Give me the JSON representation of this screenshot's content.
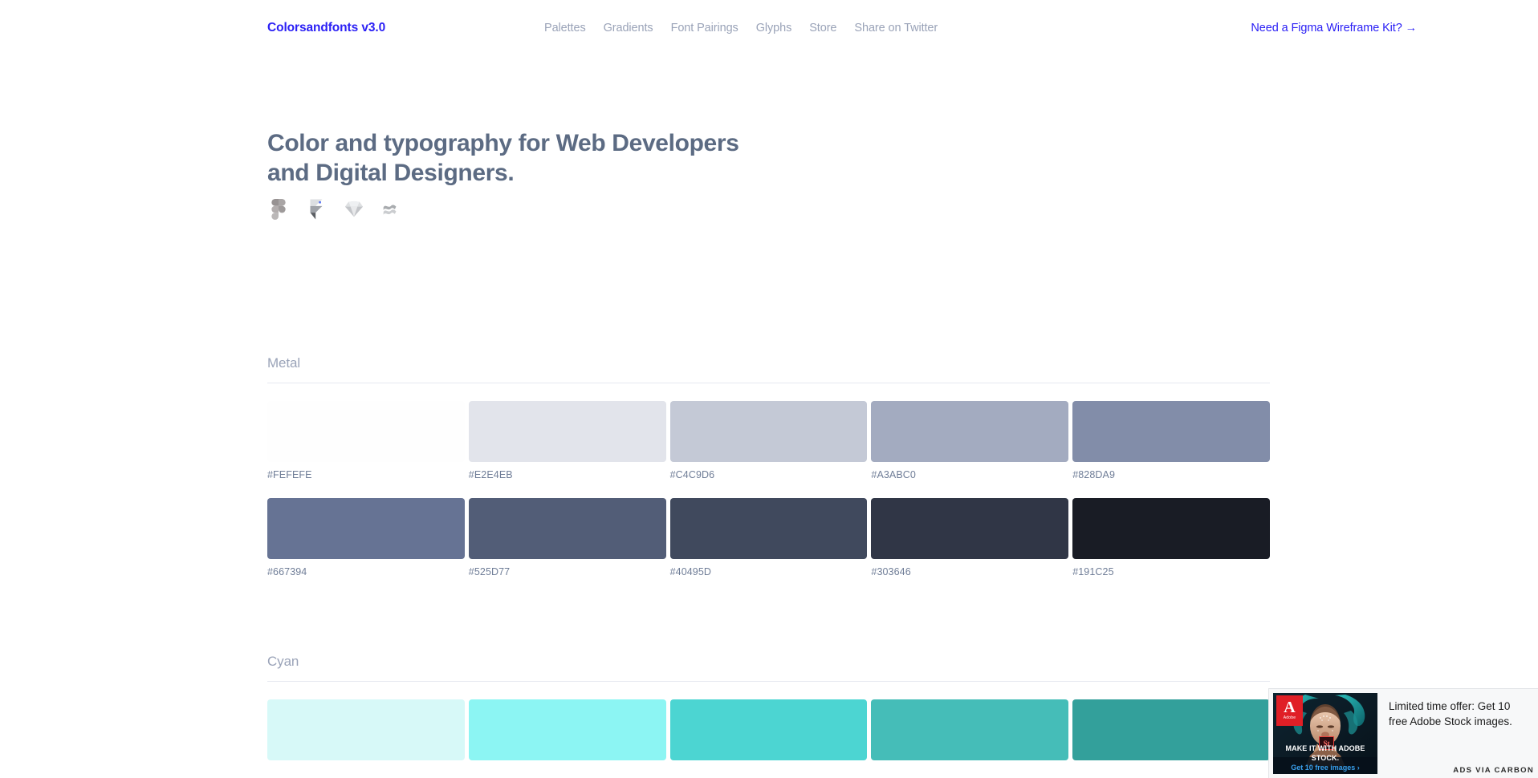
{
  "header": {
    "brand": "Colorsandfonts v3.0",
    "nav": [
      {
        "label": "Palettes",
        "name": "nav-palettes"
      },
      {
        "label": "Gradients",
        "name": "nav-gradients"
      },
      {
        "label": "Font Pairings",
        "name": "nav-font-pairings"
      },
      {
        "label": "Glyphs",
        "name": "nav-glyphs"
      },
      {
        "label": "Store",
        "name": "nav-store"
      },
      {
        "label": "Share on Twitter",
        "name": "nav-share-twitter"
      }
    ],
    "cta": "Need a Figma Wireframe Kit? →",
    "brand_color": "#2B20F5"
  },
  "hero": {
    "line1": "Color and typography for Web Developers",
    "line2": "and Digital Designers.",
    "title_color": "#5C6B83",
    "tools": [
      {
        "name": "figma-icon",
        "label": "Figma"
      },
      {
        "name": "framer-icon",
        "label": "Framer"
      },
      {
        "name": "sketch-icon",
        "label": "Sketch"
      },
      {
        "name": "adobe-xd-icon",
        "label": "Adobe XD"
      }
    ]
  },
  "sections": [
    {
      "id": "metal",
      "title": "Metal",
      "rows": [
        [
          {
            "hex": "#FEFEFE"
          },
          {
            "hex": "#E2E4EB"
          },
          {
            "hex": "#C4C9D6"
          },
          {
            "hex": "#A3ABC0"
          },
          {
            "hex": "#828DA9"
          }
        ],
        [
          {
            "hex": "#667394"
          },
          {
            "hex": "#525D77"
          },
          {
            "hex": "#40495D"
          },
          {
            "hex": "#303646"
          },
          {
            "hex": "#191C25"
          }
        ]
      ]
    },
    {
      "id": "cyan",
      "title": "Cyan",
      "rows": [
        [
          {
            "hex": "#D7F9F8"
          },
          {
            "hex": "#8CF5F3"
          },
          {
            "hex": "#4CD5D2"
          },
          {
            "hex": "#45BDB8"
          },
          {
            "hex": "#33A09B"
          }
        ]
      ]
    }
  ],
  "ad": {
    "text": "Limited time offer: Get 10 free Adobe Stock images.",
    "poweredby": "ADS VIA CARBON",
    "creative": {
      "brand": "Adobe",
      "brand_mark": "A",
      "caption_line1": "MAKE IT WITH ADOBE STOCK.",
      "caption_line2": "Get 10 free images ›",
      "product_chip": "St"
    }
  }
}
